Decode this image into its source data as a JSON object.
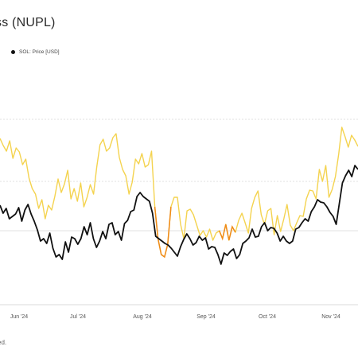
{
  "title": "ss (NUPL)",
  "legend": {
    "sol_label": "SOL: Price [USD]",
    "sol_color": "#111111"
  },
  "footnote": "ed.",
  "colors": {
    "nupl_line": "#f4d34f",
    "nupl_highlight": "#ef8a17",
    "price_line": "#111111",
    "grid": "#d6d6d6",
    "axis": "#cfcfcf"
  },
  "chart_data": {
    "type": "line",
    "x_ticks": [
      "Jun '24",
      "Jul '24",
      "Aug '24",
      "Sep '24",
      "Oct '24",
      "Nov '24"
    ],
    "series": [
      {
        "name": "",
        "role": "nupl",
        "values": [
          174,
          183,
          190,
          177,
          199,
          186,
          191,
          207,
          200,
          224,
          237,
          244,
          262,
          251,
          275,
          258,
          264,
          247,
          225,
          242,
          231,
          214,
          250,
          237,
          253,
          230,
          260,
          248,
          232,
          244,
          210,
          182,
          175,
          190,
          186,
          173,
          168,
          198,
          213,
          221,
          244,
          229,
          200,
          206,
          193,
          210,
          207,
          190,
          260,
          300,
          320,
          323,
          307,
          260,
          248,
          248,
          282,
          300,
          265,
          263,
          270,
          283,
          296,
          290,
          298,
          288,
          302,
          293,
          290,
          300,
          282,
          302,
          285,
          292,
          277,
          268,
          280,
          293,
          262,
          248,
          240,
          270,
          282,
          265,
          262,
          295,
          271,
          291,
          275,
          257,
          283,
          290,
          280,
          271,
          272,
          250,
          239,
          240,
          250,
          213,
          228,
          208,
          248,
          238,
          222,
          194,
          160,
          172,
          185,
          170,
          176,
          184
        ],
        "highlight_ranges": [
          [
            48,
            53
          ],
          [
            68,
            73
          ]
        ]
      },
      {
        "name": "SOL: Price [USD]",
        "role": "price",
        "values": [
          258,
          268,
          262,
          275,
          272,
          269,
          261,
          278,
          264,
          257,
          269,
          278,
          289,
          303,
          300,
          306,
          293,
          312,
          323,
          320,
          326,
          304,
          317,
          298,
          300,
          307,
          300,
          285,
          295,
          280,
          300,
          311,
          303,
          291,
          300,
          282,
          280,
          295,
          291,
          302,
          281,
          277,
          266,
          264,
          247,
          242,
          247,
          250,
          253,
          268,
          297,
          300,
          303,
          306,
          308,
          312,
          317,
          322,
          310,
          301,
          294,
          300,
          308,
          305,
          297,
          302,
          299,
          313,
          310,
          311,
          320,
          332,
          318,
          321,
          316,
          313,
          325,
          320,
          306,
          303,
          299,
          288,
          298,
          297,
          285,
          280,
          290,
          286,
          287,
          293,
          303,
          297,
          303,
          306,
          303,
          288,
          286,
          280,
          275,
          278,
          266,
          260,
          251,
          254,
          255,
          260,
          267,
          272,
          282,
          256,
          230,
          221,
          214,
          222,
          208,
          213
        ]
      }
    ],
    "ref_lines": [
      "dashed",
      "dashed",
      "solid"
    ]
  }
}
